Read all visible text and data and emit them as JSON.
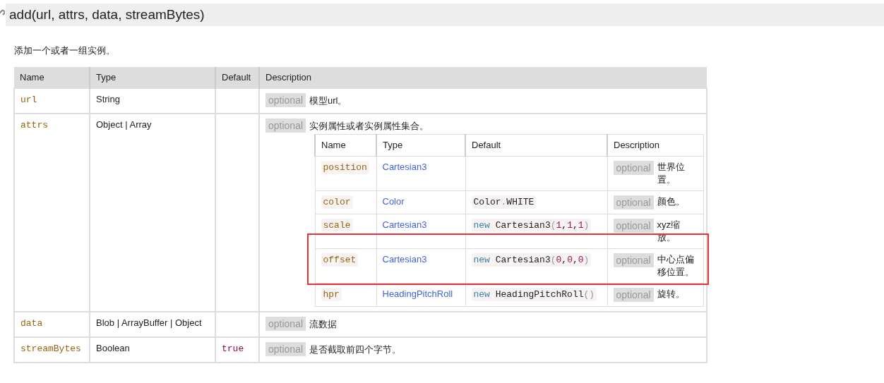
{
  "method": {
    "signature": "add(url, attrs, data, streamBytes)"
  },
  "summary": "添加一个或者一组实例。",
  "params": {
    "columns": [
      "Name",
      "Type",
      "Default",
      "Description"
    ],
    "rows": [
      {
        "name": "url",
        "type": "String",
        "badge": "optional",
        "description": "模型url。"
      },
      {
        "name": "attrs",
        "type": "Object | Array",
        "badge": "optional",
        "description": "实例属性或者实例属性集合。",
        "properties": {
          "columns": [
            "Name",
            "Type",
            "Default",
            "Description"
          ],
          "rows": [
            {
              "name": "position",
              "type": "Cartesian3",
              "badge": "optional",
              "description": "世界位置。",
              "highlighted": false
            },
            {
              "name": "color",
              "type": "Color",
              "default": [
                {
                  "text": "Color",
                  "kind": "plain"
                },
                {
                  "text": ".",
                  "kind": "punct"
                },
                {
                  "text": "WHITE",
                  "kind": "plain"
                }
              ],
              "badge": "optional",
              "description": "颜色。",
              "highlighted": false
            },
            {
              "name": "scale",
              "type": "Cartesian3",
              "default": [
                {
                  "text": "new",
                  "kind": "keyword"
                },
                {
                  "text": " Cartesian3",
                  "kind": "plain"
                },
                {
                  "text": "(",
                  "kind": "punct"
                },
                {
                  "text": "1",
                  "kind": "number"
                },
                {
                  "text": ",",
                  "kind": "plain"
                },
                {
                  "text": "1",
                  "kind": "number"
                },
                {
                  "text": ",",
                  "kind": "plain"
                },
                {
                  "text": "1",
                  "kind": "number"
                },
                {
                  "text": ")",
                  "kind": "punct"
                }
              ],
              "badge": "optional",
              "description": "xyz缩放。",
              "highlighted": false
            },
            {
              "name": "offset",
              "type": "Cartesian3",
              "default": [
                {
                  "text": "new",
                  "kind": "keyword"
                },
                {
                  "text": " Cartesian3",
                  "kind": "plain"
                },
                {
                  "text": "(",
                  "kind": "punct"
                },
                {
                  "text": "0",
                  "kind": "number"
                },
                {
                  "text": ",",
                  "kind": "plain"
                },
                {
                  "text": "0",
                  "kind": "number"
                },
                {
                  "text": ",",
                  "kind": "plain"
                },
                {
                  "text": "0",
                  "kind": "number"
                },
                {
                  "text": ")",
                  "kind": "punct"
                }
              ],
              "badge": "optional",
              "description": "中心点偏移位置。",
              "highlighted": true
            },
            {
              "name": "hpr",
              "type": "HeadingPitchRoll",
              "default": [
                {
                  "text": "new",
                  "kind": "keyword"
                },
                {
                  "text": " HeadingPitchRoll",
                  "kind": "plain"
                },
                {
                  "text": "()",
                  "kind": "punct"
                }
              ],
              "badge": "optional",
              "description": "旋转。",
              "highlighted": false
            }
          ]
        }
      },
      {
        "name": "data",
        "type": "Blob | ArrayBuffer | Object",
        "badge": "optional",
        "description": "流数据"
      },
      {
        "name": "streamBytes",
        "type": "Boolean",
        "default": [
          {
            "text": "true",
            "kind": "literal"
          }
        ],
        "badge": "optional",
        "description": "是否截取前四个字节。"
      }
    ]
  }
}
